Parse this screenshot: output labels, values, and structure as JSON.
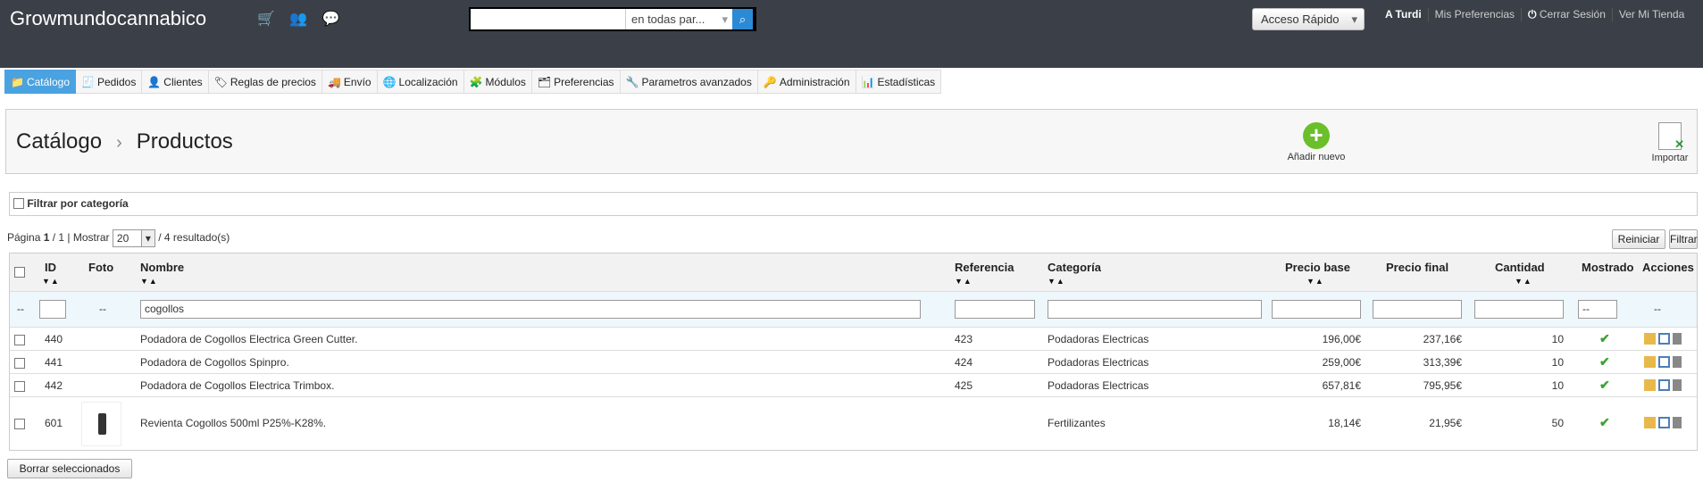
{
  "header": {
    "brand": "Growmundocannabico",
    "icons": [
      "cart-icon",
      "users-icon",
      "messages-icon"
    ],
    "search": {
      "value": "",
      "scope": "en todas par..."
    },
    "quick_access": "Acceso Rápido",
    "links": [
      "A Turdi",
      "Mis Preferencias",
      "Cerrar Sesión",
      "Ver Mi Tienda"
    ]
  },
  "tabs": [
    {
      "label": "Catálogo",
      "icon": "folder-icon",
      "active": true
    },
    {
      "label": "Pedidos",
      "icon": "orders-icon"
    },
    {
      "label": "Clientes",
      "icon": "customer-icon"
    },
    {
      "label": "Reglas de precios",
      "icon": "price-rules-icon"
    },
    {
      "label": "Envío",
      "icon": "truck-icon"
    },
    {
      "label": "Localización",
      "icon": "globe-icon"
    },
    {
      "label": "Módulos",
      "icon": "puzzle-icon"
    },
    {
      "label": "Preferencias",
      "icon": "preferences-icon"
    },
    {
      "label": "Parametros avanzados",
      "icon": "wrench-icon"
    },
    {
      "label": "Administración",
      "icon": "key-icon"
    },
    {
      "label": "Estadísticas",
      "icon": "stats-icon"
    }
  ],
  "toolbar": {
    "crumb1": "Catálogo",
    "crumb2": "Productos",
    "add": "Añadir nuevo",
    "import": "Importar"
  },
  "filter_category": "Filtrar por categoría",
  "pagination": {
    "prefix": "Página",
    "page": "1",
    "rest": "/ 1 | Mostrar",
    "per_page": "20",
    "results": "/ 4 resultado(s)"
  },
  "buttons": {
    "reset": "Reiniciar",
    "filter": "Filtrar",
    "delete_selected": "Borrar seleccionados"
  },
  "table": {
    "headers": {
      "id": "ID",
      "photo": "Foto",
      "name": "Nombre",
      "reference": "Referencia",
      "category": "Categoría",
      "base_price": "Precio base",
      "final_price": "Precio final",
      "quantity": "Cantidad",
      "shown": "Mostrado",
      "actions": "Acciones"
    },
    "filters": {
      "dash": "--",
      "name": "cogollos",
      "shown": "--"
    },
    "rows": [
      {
        "id": "440",
        "name": "Podadora de Cogollos Electrica Green Cutter.",
        "ref": "423",
        "cat": "Podadoras Electricas",
        "base": "196,00€",
        "final": "237,16€",
        "qty": "10"
      },
      {
        "id": "441",
        "name": "Podadora de Cogollos Spinpro.",
        "ref": "424",
        "cat": "Podadoras Electricas",
        "base": "259,00€",
        "final": "313,39€",
        "qty": "10"
      },
      {
        "id": "442",
        "name": "Podadora de Cogollos Electrica Trimbox.",
        "ref": "425",
        "cat": "Podadoras Electricas",
        "base": "657,81€",
        "final": "795,95€",
        "qty": "10"
      },
      {
        "id": "601",
        "name": "Revienta Cogollos 500ml P25%-K28%.",
        "ref": "",
        "cat": "Fertilizantes",
        "base": "18,14€",
        "final": "21,95€",
        "qty": "50"
      }
    ]
  }
}
